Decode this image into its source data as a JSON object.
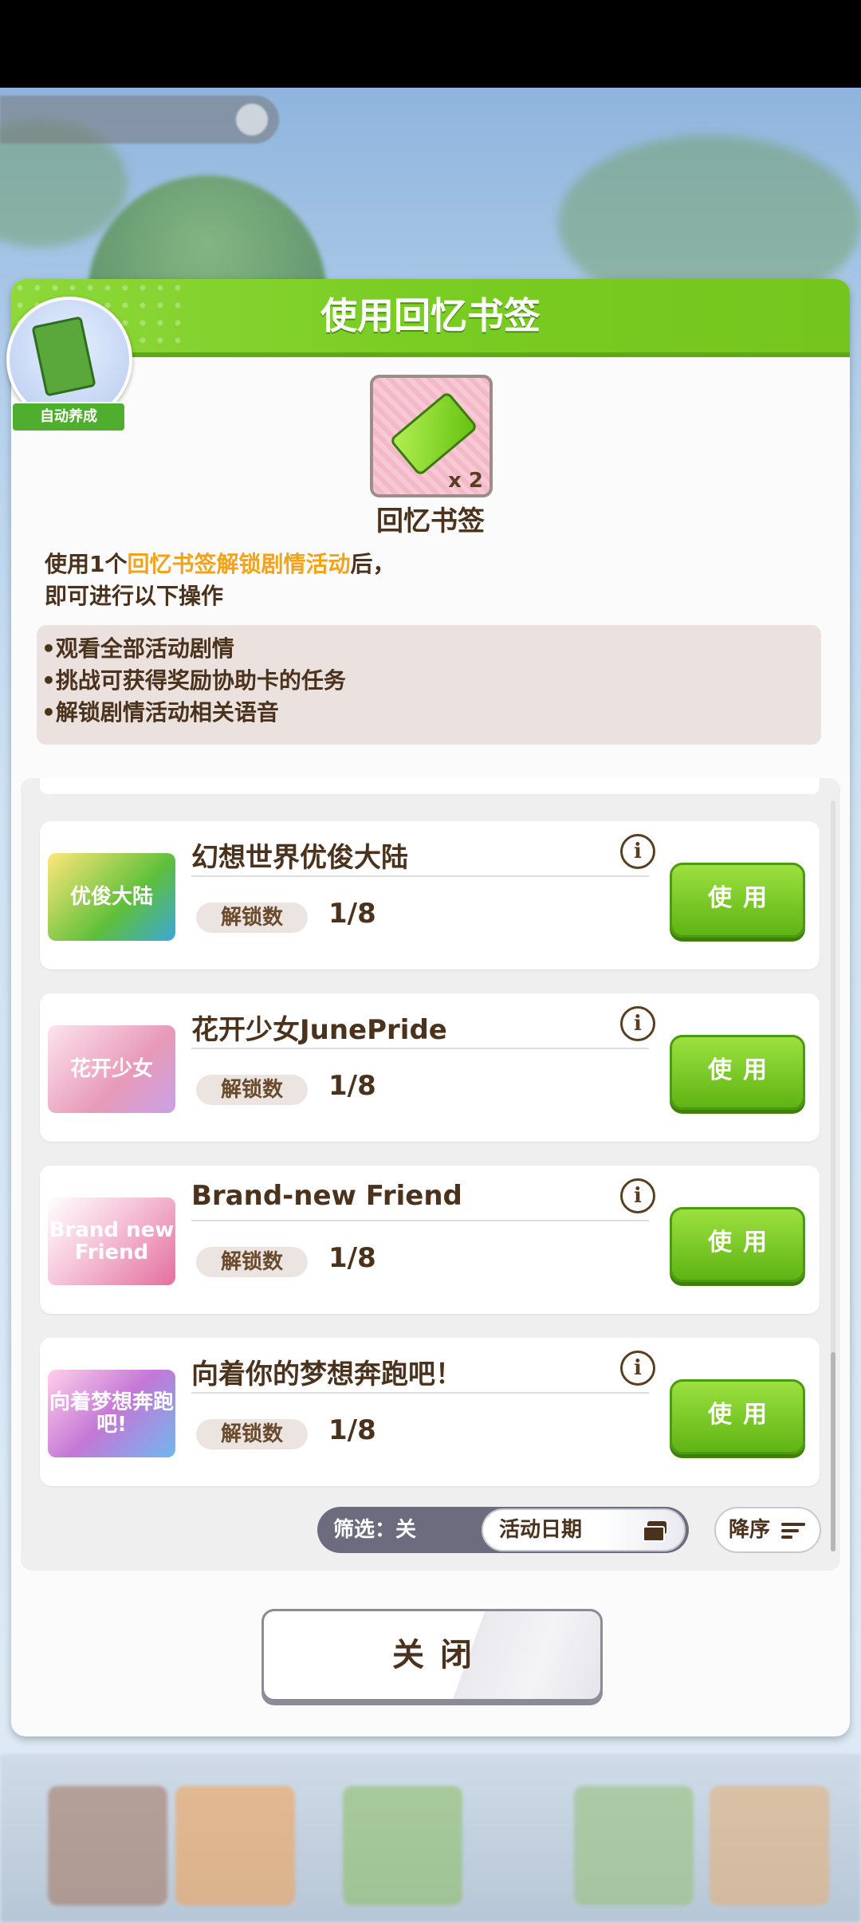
{
  "header": {
    "title": "使用回忆书签"
  },
  "auto_badge": {
    "label": "自动养成"
  },
  "item": {
    "name": "回忆书签",
    "quantity": "x 2"
  },
  "description": {
    "part1": "使用1个",
    "highlight1": "回忆书签",
    "highlight2": "解锁剧情活动",
    "part2": "后，",
    "line2": "即可进行以下操作"
  },
  "bullets": [
    "•观看全部活动剧情",
    "•挑战可获得奖励协助卡的任务",
    "•解锁剧情活动相关语音"
  ],
  "events": [
    {
      "title": "幻想世界优俊大陆",
      "logo_text": "优俊大陆",
      "unlock_label": "解锁数",
      "unlock_value": "1/8",
      "use_label": "使用",
      "logo_color": "#5fbf3a"
    },
    {
      "title": "花开少女JunePride",
      "logo_text": "花开少女",
      "unlock_label": "解锁数",
      "unlock_value": "1/8",
      "use_label": "使用",
      "logo_color": "#e79ab8"
    },
    {
      "title": "Brand-new Friend",
      "logo_text": "Brand new Friend",
      "unlock_label": "解锁数",
      "unlock_value": "1/8",
      "use_label": "使用",
      "logo_color": "#e46f9f"
    },
    {
      "title": "向着你的梦想奔跑吧！",
      "logo_text": "向着梦想奔跑吧!",
      "unlock_label": "解锁数",
      "unlock_value": "1/8",
      "use_label": "使用",
      "logo_color": "#c477d6"
    }
  ],
  "filter": {
    "label": "筛选：关",
    "sort_field": "活动日期",
    "order": "降序"
  },
  "close_label": "关闭",
  "colors": {
    "accent_green": "#79cc22",
    "highlight": "#f2a31a",
    "text_brown": "#4a321c"
  }
}
